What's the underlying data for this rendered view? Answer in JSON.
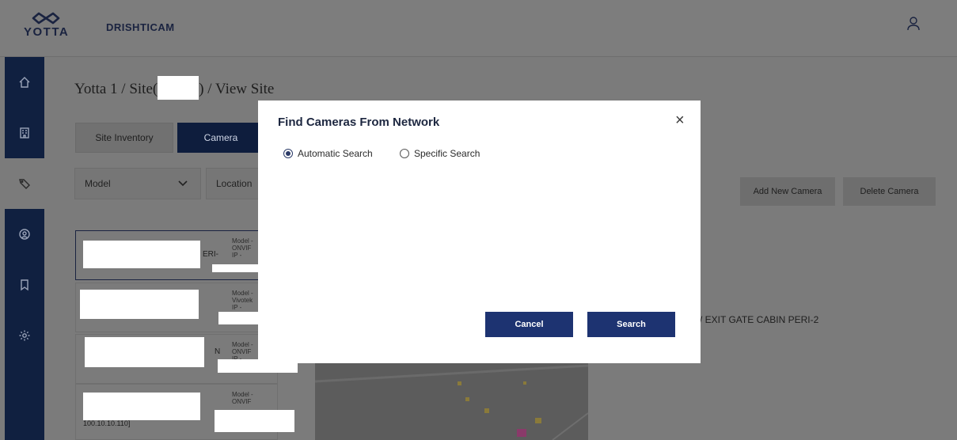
{
  "header": {
    "logo_text": "YOTTA",
    "brand": "DRISHTICAM",
    "colors": {
      "navy": "#102040",
      "overlay": "#7b7b7b"
    }
  },
  "sidebar": {
    "items": [
      {
        "icon": "home-icon"
      },
      {
        "icon": "building-icon"
      },
      {
        "icon": "tag-icon",
        "active": true
      },
      {
        "icon": "user-circle-icon"
      },
      {
        "icon": "bookmark-icon"
      },
      {
        "icon": "gear-icon"
      }
    ]
  },
  "breadcrumb": {
    "prefix": "Yotta 1 / Site(",
    "suffix": ") / View Site"
  },
  "tabs": {
    "site_inventory": "Site Inventory",
    "camera": "Camera"
  },
  "filters": {
    "model": "Model",
    "location": "Location"
  },
  "actions": {
    "add_new_camera": "Add New Camera",
    "delete_camera": "Delete Camera"
  },
  "camera_cards": [
    {
      "fragment": "ERI-",
      "meta": [
        "Model -",
        "ONVIF",
        "IP -"
      ]
    },
    {
      "fragment": "",
      "meta": [
        "Model -",
        "Vivotek",
        "IP -"
      ]
    },
    {
      "fragment": "N",
      "meta": [
        "Model -",
        "ONVIF",
        "IP -"
      ]
    },
    {
      "fragment": "100.10.10.110]",
      "meta": [
        "Model -",
        "ONVIF"
      ]
    }
  ],
  "preview_label": "/ EXIT GATE CABIN PERI-2",
  "modal": {
    "title": "Find Cameras From Network",
    "close": "×",
    "options": {
      "automatic": "Automatic Search",
      "specific": "Specific Search",
      "selected": "automatic"
    },
    "cancel": "Cancel",
    "search": "Search",
    "button_color": "#1d3371"
  }
}
